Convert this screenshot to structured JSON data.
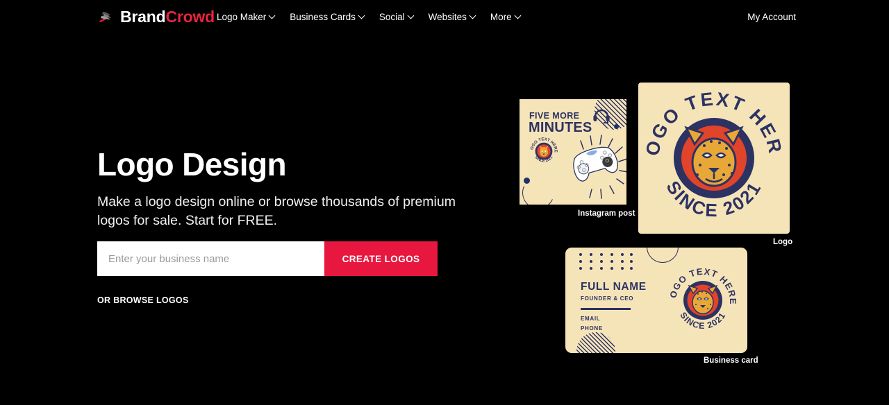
{
  "header": {
    "brand": {
      "name_part1": "Brand",
      "name_part2": "Crowd",
      "mark_icon": "brandcrowd-bird-mark"
    },
    "nav": [
      {
        "label": "Logo Maker",
        "icon": "chevron-down-icon"
      },
      {
        "label": "Business Cards",
        "icon": "chevron-down-icon"
      },
      {
        "label": "Social",
        "icon": "chevron-down-icon"
      },
      {
        "label": "Websites",
        "icon": "chevron-down-icon"
      },
      {
        "label": "More",
        "icon": "chevron-down-icon"
      }
    ],
    "account_label": "My Account"
  },
  "hero": {
    "title": "Logo Design",
    "subtitle": "Make a logo design online or browse thousands of premium logos for sale. Start for FREE.",
    "search_placeholder": "Enter your business name",
    "search_value": "",
    "cta_label": "CREATE LOGOS",
    "browse_label": "OR BROWSE LOGOS"
  },
  "showcase": {
    "instagram": {
      "caption": "Instagram post",
      "headline_line1": "FIVE MORE",
      "headline_line2": "MINUTES",
      "icons": [
        "headphones-icon",
        "game-controller-icon",
        "striped-circle-decoration",
        "navy-dot-decoration"
      ],
      "badge": {
        "top_text": "LOGO TEXT HERE",
        "bottom_text": "SINCE 2021",
        "animal": "cheetah-head-icon"
      }
    },
    "logo": {
      "caption": "Logo",
      "badge": {
        "top_text": "LOGO TEXT HERE",
        "bottom_text": "SINCE 2021",
        "animal": "cheetah-head-icon"
      }
    },
    "business_card": {
      "caption": "Business card",
      "full_name": "FULL NAME",
      "role": "FOUNDER & CEO",
      "email_label": "EMAIL",
      "phone_label": "PHONE",
      "badge": {
        "top_text": "LOGO TEXT HERE",
        "bottom_text": "SINCE 2021",
        "animal": "cheetah-head-icon"
      }
    }
  },
  "colors": {
    "page_background": "#000000",
    "accent_red": "#e8173f",
    "brand_red": "#e8243f",
    "cream": "#f6e4b9",
    "navy": "#2c3262",
    "logo_red": "#e0442a",
    "gold": "#e8a838",
    "white": "#ffffff"
  }
}
